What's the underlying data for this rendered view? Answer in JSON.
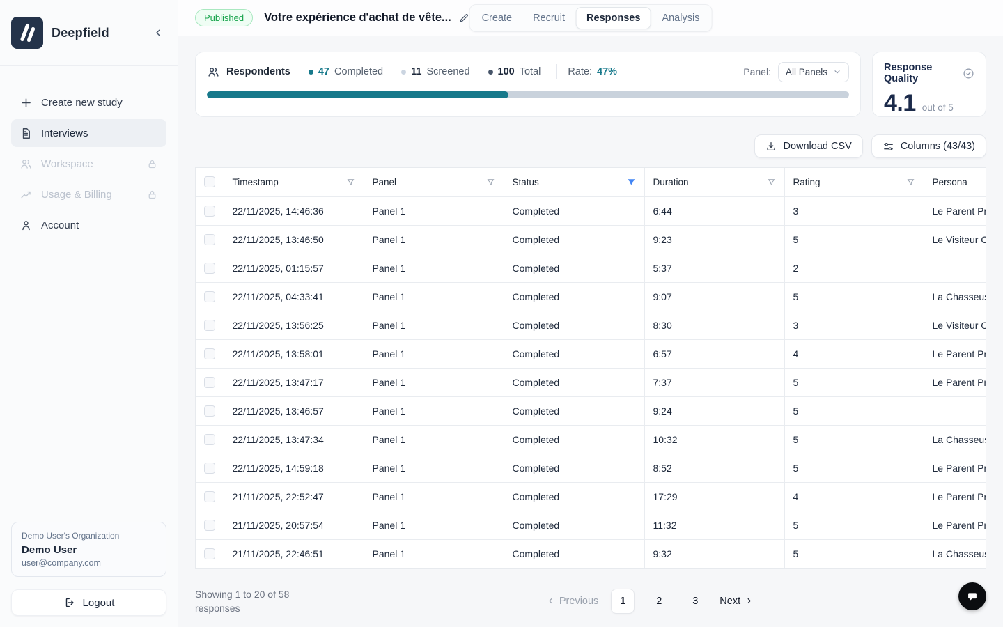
{
  "sidebar": {
    "brand": "Deepfield",
    "items": [
      {
        "label": "Create new study",
        "icon": "plus-icon",
        "state": "normal"
      },
      {
        "label": "Interviews",
        "icon": "document-icon",
        "state": "active"
      },
      {
        "label": "Workspace",
        "icon": "people-icon",
        "state": "locked"
      },
      {
        "label": "Usage & Billing",
        "icon": "trend-icon",
        "state": "locked"
      },
      {
        "label": "Account",
        "icon": "person-icon",
        "state": "normal"
      }
    ],
    "user": {
      "org": "Demo User's Organization",
      "name": "Demo User",
      "email": "user@company.com"
    },
    "logout_label": "Logout"
  },
  "header": {
    "status_badge": "Published",
    "title": "Votre expérience d'achat de vête...",
    "tabs": [
      {
        "label": "Create",
        "active": false
      },
      {
        "label": "Recruit",
        "active": false
      },
      {
        "label": "Responses",
        "active": true
      },
      {
        "label": "Analysis",
        "active": false
      }
    ]
  },
  "stats": {
    "label": "Respondents",
    "completed_value": "47",
    "completed_label": "Completed",
    "screened_value": "11",
    "screened_label": "Screened",
    "total_value": "100",
    "total_label": "Total",
    "rate_label": "Rate:",
    "rate_value": "47%",
    "panel_label": "Panel:",
    "panel_value": "All Panels",
    "progress_pct": 47
  },
  "quality": {
    "title": "Response Quality",
    "score": "4.1",
    "suffix": "out of 5"
  },
  "toolbar": {
    "download_label": "Download CSV",
    "columns_label": "Columns (43/43)"
  },
  "table": {
    "columns": [
      "Timestamp",
      "Panel",
      "Status",
      "Duration",
      "Rating",
      "Persona"
    ],
    "active_filter_column": "Status",
    "rows": [
      [
        "22/11/2025, 14:46:36",
        "Panel 1",
        "Completed",
        "6:44",
        "3",
        "Le Parent Pr"
      ],
      [
        "22/11/2025, 13:46:50",
        "Panel 1",
        "Completed",
        "9:23",
        "5",
        "Le Visiteur C"
      ],
      [
        "22/11/2025, 01:15:57",
        "Panel 1",
        "Completed",
        "5:37",
        "2",
        ""
      ],
      [
        "22/11/2025, 04:33:41",
        "Panel 1",
        "Completed",
        "9:07",
        "5",
        "La Chasseus"
      ],
      [
        "22/11/2025, 13:56:25",
        "Panel 1",
        "Completed",
        "8:30",
        "3",
        "Le Visiteur C"
      ],
      [
        "22/11/2025, 13:58:01",
        "Panel 1",
        "Completed",
        "6:57",
        "4",
        "Le Parent Pr"
      ],
      [
        "22/11/2025, 13:47:17",
        "Panel 1",
        "Completed",
        "7:37",
        "5",
        "Le Parent Pr"
      ],
      [
        "22/11/2025, 13:46:57",
        "Panel 1",
        "Completed",
        "9:24",
        "5",
        ""
      ],
      [
        "22/11/2025, 13:47:34",
        "Panel 1",
        "Completed",
        "10:32",
        "5",
        "La Chasseus"
      ],
      [
        "22/11/2025, 14:59:18",
        "Panel 1",
        "Completed",
        "8:52",
        "5",
        "Le Parent Pr"
      ],
      [
        "21/11/2025, 22:52:47",
        "Panel 1",
        "Completed",
        "17:29",
        "4",
        "Le Parent Pr"
      ],
      [
        "21/11/2025, 20:57:54",
        "Panel 1",
        "Completed",
        "11:32",
        "5",
        "Le Parent Pr"
      ],
      [
        "21/11/2025, 22:46:51",
        "Panel 1",
        "Completed",
        "9:32",
        "5",
        "La Chasseus"
      ]
    ]
  },
  "pagination": {
    "summary_line1": "Showing 1 to 20 of 58",
    "summary_line2": "responses",
    "previous_label": "Previous",
    "pages": [
      "1",
      "2",
      "3"
    ],
    "active_page": "1",
    "next_label": "Next"
  },
  "icons": {
    "logo": "deepfield-slash-mark",
    "collapse": "chevron-left",
    "respondents": "people",
    "quality": "check-circle",
    "download": "download-arrow-tray",
    "columns": "sliders",
    "filter": "funnel",
    "fab": "chat-bubble"
  },
  "colors": {
    "accent_teal": "#17798b",
    "published_green": "#16a34a",
    "filter_active_blue": "#4285f4",
    "navy_text": "#1b2a4a",
    "fab_black": "#0b0d10"
  }
}
